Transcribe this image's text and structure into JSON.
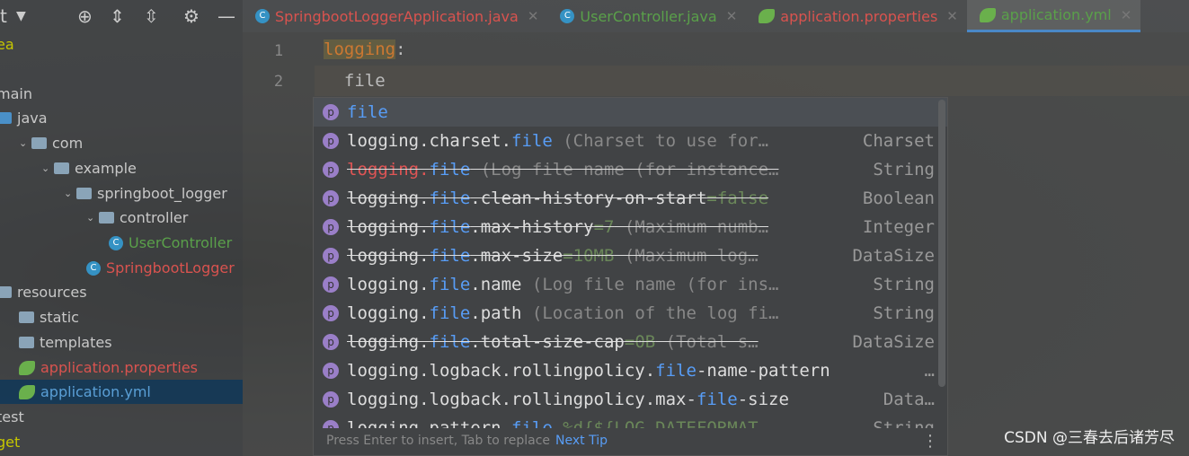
{
  "sidebar": {
    "title_fragment": "t",
    "items": [
      {
        "label": "ea",
        "indent": 0,
        "kind": "text",
        "color": "#c6c600"
      },
      {
        "label": "main",
        "indent": 0,
        "kind": "text"
      },
      {
        "label": "java",
        "indent": 0,
        "kind": "folder-blue"
      },
      {
        "label": "com",
        "indent": 1,
        "kind": "folder",
        "chev": true
      },
      {
        "label": "example",
        "indent": 2,
        "kind": "folder",
        "chev": true
      },
      {
        "label": "springboot_logger",
        "indent": 3,
        "kind": "folder",
        "chev": true
      },
      {
        "label": "controller",
        "indent": 4,
        "kind": "folder",
        "chev": true
      },
      {
        "label": "UserController",
        "indent": 5,
        "kind": "class",
        "color": "#5aa04a"
      },
      {
        "label": "SpringbootLogger",
        "indent": 4,
        "kind": "class",
        "color": "#d9534f"
      },
      {
        "label": "resources",
        "indent": 0,
        "kind": "folder"
      },
      {
        "label": "static",
        "indent": 1,
        "kind": "folder"
      },
      {
        "label": "templates",
        "indent": 1,
        "kind": "folder"
      },
      {
        "label": "application.properties",
        "indent": 1,
        "kind": "leaf",
        "color": "#d9534f"
      },
      {
        "label": "application.yml",
        "indent": 1,
        "kind": "leaf",
        "color": "#5a9fd6",
        "selected": true
      },
      {
        "label": "test",
        "indent": 0,
        "kind": "text"
      },
      {
        "label": "get",
        "indent": 0,
        "kind": "text",
        "color": "#c6c600"
      }
    ]
  },
  "tabs": [
    {
      "label": "SpringbootLoggerApplication.java",
      "color": "red",
      "icon": "class-icon"
    },
    {
      "label": "UserController.java",
      "color": "green",
      "icon": "class-icon"
    },
    {
      "label": "application.properties",
      "color": "red",
      "icon": "spring-leaf-icon"
    },
    {
      "label": "application.yml",
      "color": "green",
      "icon": "spring-leaf-icon",
      "active": true
    }
  ],
  "editor": {
    "lines": [
      {
        "num": "1",
        "key": "logging",
        "rest": ":"
      },
      {
        "num": "2",
        "text": "  file"
      }
    ]
  },
  "popup": {
    "items": [
      {
        "parts": [
          [
            "h",
            "file"
          ]
        ],
        "type": "",
        "selected": true
      },
      {
        "parts": [
          [
            "n",
            "logging.charset."
          ],
          [
            "h",
            "file"
          ],
          [
            "d",
            " (Charset to use for…"
          ]
        ],
        "type": "Charset"
      },
      {
        "parts": [
          [
            "r",
            "logging."
          ],
          [
            "h",
            "file"
          ],
          [
            "d",
            " (Log file name (for instance…"
          ]
        ],
        "type": "String",
        "deprecated": true
      },
      {
        "parts": [
          [
            "n",
            "logging."
          ],
          [
            "h",
            "file"
          ],
          [
            "n",
            ".clean-history-on-start"
          ],
          [
            "g",
            "=false"
          ]
        ],
        "type": "Boolean",
        "deprecated": true
      },
      {
        "parts": [
          [
            "n",
            "logging."
          ],
          [
            "h",
            "file"
          ],
          [
            "n",
            ".max-history"
          ],
          [
            "g",
            "=7"
          ],
          [
            "d",
            " (Maximum numb…"
          ]
        ],
        "type": "Integer",
        "deprecated": true
      },
      {
        "parts": [
          [
            "n",
            "logging."
          ],
          [
            "h",
            "file"
          ],
          [
            "n",
            ".max-size"
          ],
          [
            "g",
            "=10MB"
          ],
          [
            "d",
            " (Maximum log…"
          ]
        ],
        "type": "DataSize",
        "deprecated": true
      },
      {
        "parts": [
          [
            "n",
            "logging."
          ],
          [
            "h",
            "file"
          ],
          [
            "n",
            ".name"
          ],
          [
            "d",
            " (Log file name (for ins…"
          ]
        ],
        "type": "String"
      },
      {
        "parts": [
          [
            "n",
            "logging."
          ],
          [
            "h",
            "file"
          ],
          [
            "n",
            ".path"
          ],
          [
            "d",
            " (Location of the log fi…"
          ]
        ],
        "type": "String"
      },
      {
        "parts": [
          [
            "n",
            "logging."
          ],
          [
            "h",
            "file"
          ],
          [
            "n",
            ".total-size-cap"
          ],
          [
            "g",
            "=0B"
          ],
          [
            "d",
            " (Total s…"
          ]
        ],
        "type": "DataSize",
        "deprecated": true
      },
      {
        "parts": [
          [
            "n",
            "logging.logback.rollingpolicy."
          ],
          [
            "h",
            "file"
          ],
          [
            "n",
            "-name-pattern"
          ]
        ],
        "type": "…"
      },
      {
        "parts": [
          [
            "n",
            "logging.logback.rollingpolicy.max-"
          ],
          [
            "h",
            "file"
          ],
          [
            "n",
            "-size"
          ]
        ],
        "type": "Data…"
      },
      {
        "parts": [
          [
            "n",
            "logging.pattern."
          ],
          [
            "h",
            "file"
          ],
          [
            "g",
            " %d{${LOG_DATEFORMAT…"
          ]
        ],
        "type": "String"
      }
    ],
    "footer_hint": "Press Enter to insert, Tab to replace",
    "footer_link": "Next Tip"
  },
  "watermark": "CSDN @三春去后诸芳尽"
}
